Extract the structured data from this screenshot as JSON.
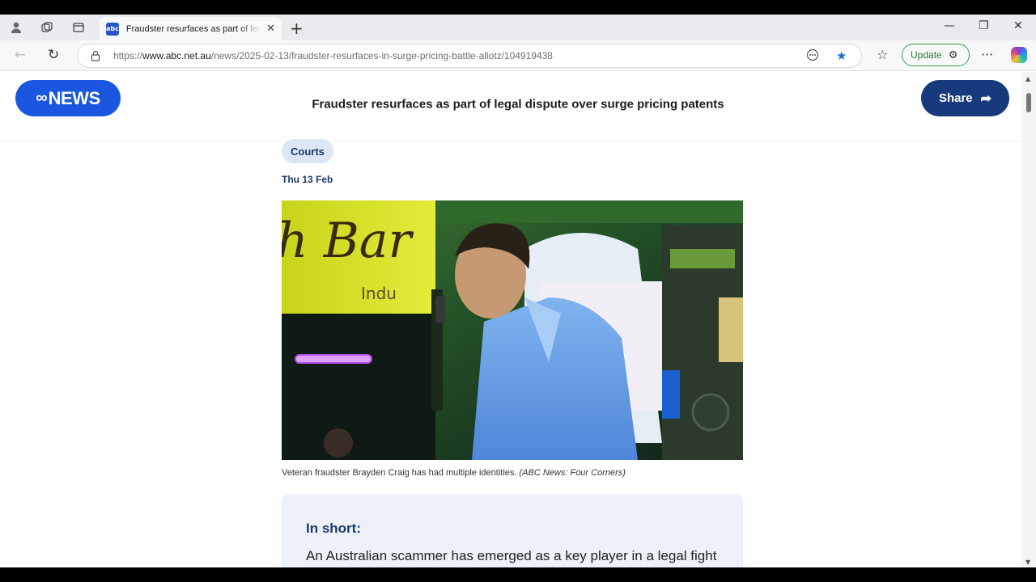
{
  "browser": {
    "tab": {
      "title": "Fraudster resurfaces as part of legal dispute over surge pricing patents",
      "favicon_text": "abc"
    },
    "address": {
      "url_prefix": "https://",
      "url_host": "www.abc.net.au",
      "url_path": "/news/2025-02-13/fraudster-resurfaces-in-surge-pricing-battle-allotz/104919438"
    },
    "update_label": "Update",
    "icons": {
      "close": "✕",
      "new_tab": "+",
      "minimize": "—",
      "restore": "❐",
      "window_close": "✕",
      "back": "←",
      "refresh": "↻",
      "star": "★",
      "favorites": "☆",
      "more": "···"
    }
  },
  "header": {
    "logo_mark": "ABC",
    "logo_text": "NEWS",
    "title": "Fraudster resurfaces as part of legal dispute over surge pricing patents",
    "share_label": "Share",
    "share_icon": "➦"
  },
  "article": {
    "category": "Courts",
    "date": "Thu 13 Feb",
    "photo_sign_text": "h Bar",
    "photo_sign_sub": "Indu",
    "caption": "Veteran fraudster Brayden Craig has had multiple identities.",
    "caption_credit": "(ABC News: Four Corners)",
    "in_short_title": "In short:",
    "in_short_body": "An Australian scammer has emerged as a key player in a legal fight over surge pricing patents that are potentially worth over"
  },
  "colors": {
    "brand_blue": "#1a56e0",
    "share_navy": "#163a7c",
    "chip_bg": "#dde6f5",
    "inshort_bg": "#edf1f8"
  }
}
